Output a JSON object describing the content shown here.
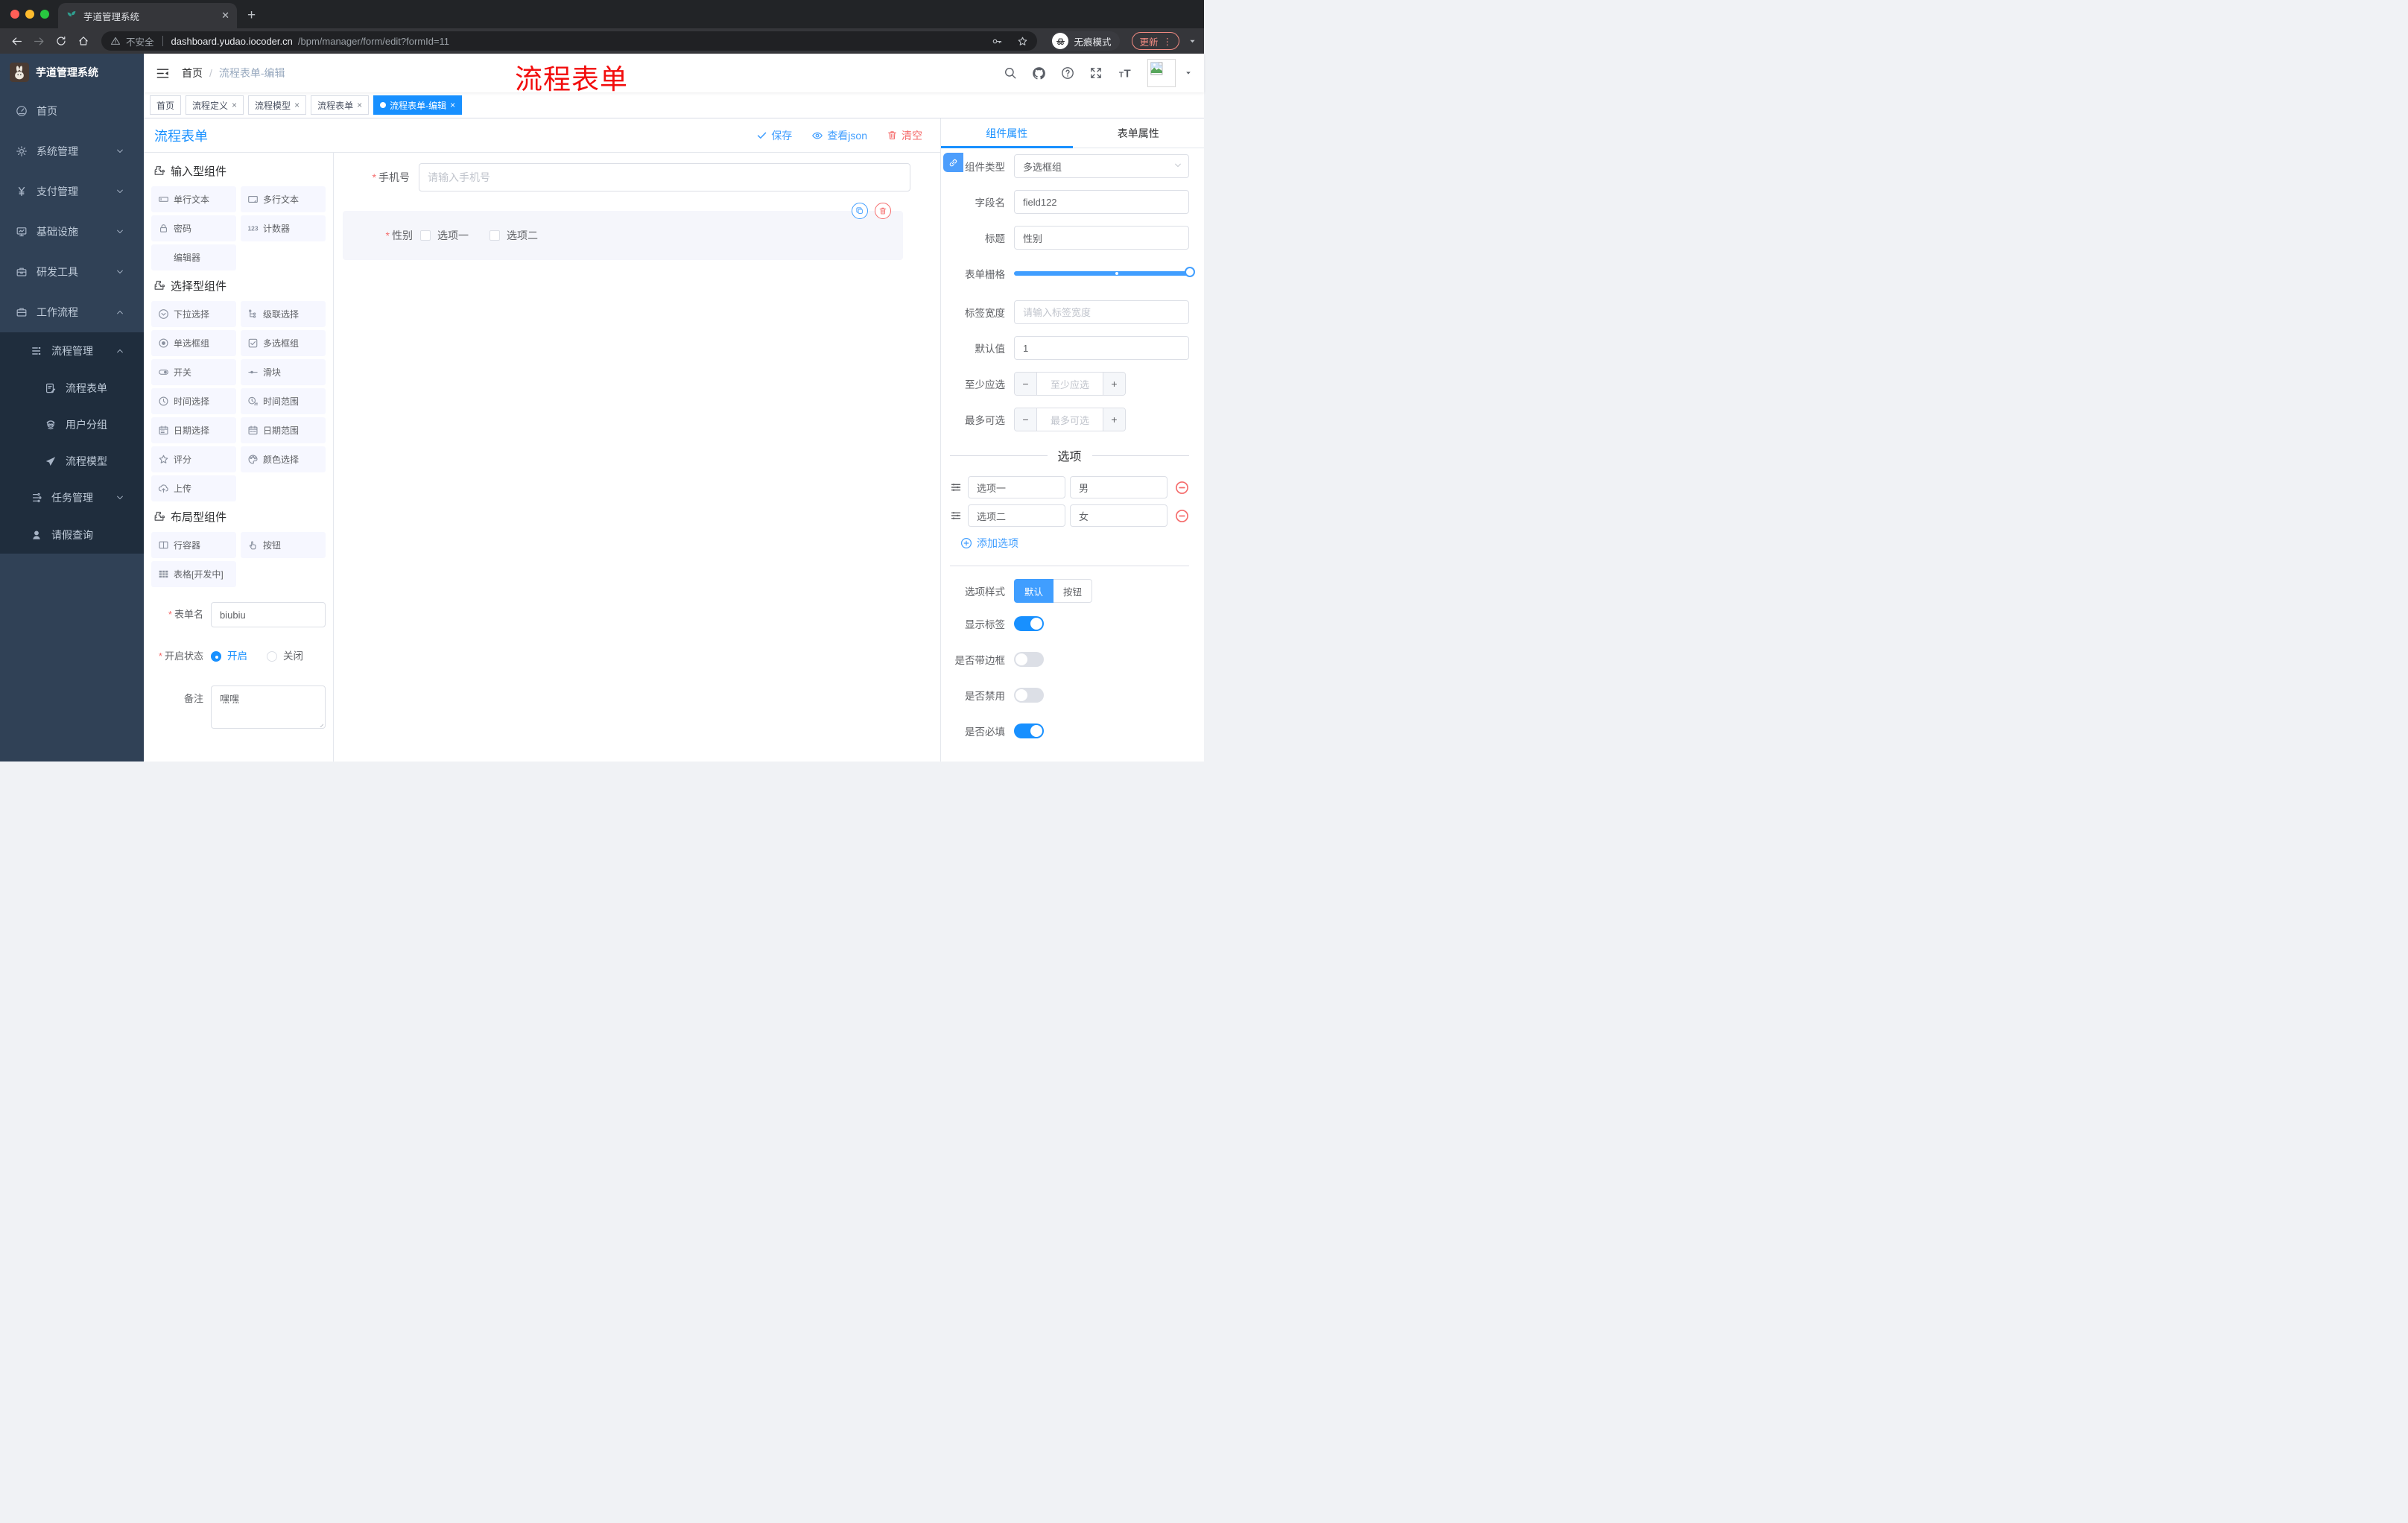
{
  "browser": {
    "tab_title": "芋道管理系统",
    "tab_close": "✕",
    "new_tab": "+",
    "security_label": "不安全",
    "url_host": "dashboard.yudao.iocoder.cn",
    "url_path": "/bpm/manager/form/edit?formId=11",
    "incognito_label": "无痕模式",
    "update_label": "更新",
    "menu_dots": "⋮"
  },
  "sidebar": {
    "logo_title": "芋道管理系统",
    "items": [
      {
        "label": "首页",
        "icon": "dashboard-icon",
        "level": 0,
        "dark": false,
        "chevron": ""
      },
      {
        "label": "系统管理",
        "icon": "gear-icon",
        "level": 0,
        "dark": false,
        "chevron": "down"
      },
      {
        "label": "支付管理",
        "icon": "yen-icon",
        "level": 0,
        "dark": false,
        "chevron": "down"
      },
      {
        "label": "基础设施",
        "icon": "monitor-icon",
        "level": 0,
        "dark": false,
        "chevron": "down"
      },
      {
        "label": "研发工具",
        "icon": "toolbox-icon",
        "level": 0,
        "dark": false,
        "chevron": "down"
      },
      {
        "label": "工作流程",
        "icon": "workflow-icon",
        "level": 0,
        "dark": false,
        "chevron": "up"
      },
      {
        "label": "流程管理",
        "icon": "list-tree-icon",
        "level": 1,
        "dark": true,
        "chevron": "up"
      },
      {
        "label": "流程表单",
        "icon": "doc-edit-icon",
        "level": 2,
        "dark": true,
        "chevron": ""
      },
      {
        "label": "用户分组",
        "icon": "user-group-icon",
        "level": 2,
        "dark": true,
        "chevron": ""
      },
      {
        "label": "流程模型",
        "icon": "paper-plane-icon",
        "level": 2,
        "dark": true,
        "chevron": ""
      },
      {
        "label": "任务管理",
        "icon": "tree-icon",
        "level": 1,
        "dark": true,
        "chevron": "down"
      },
      {
        "label": "请假查询",
        "icon": "user-icon",
        "level": 1,
        "dark": true,
        "chevron": ""
      }
    ]
  },
  "navbar": {
    "breadcrumb": [
      "首页",
      "流程表单-编辑"
    ],
    "breadcrumb_separator": "/",
    "annotation": "流程表单"
  },
  "tags": [
    {
      "label": "首页",
      "closable": false,
      "active": false
    },
    {
      "label": "流程定义",
      "closable": true,
      "active": false
    },
    {
      "label": "流程模型",
      "closable": true,
      "active": false
    },
    {
      "label": "流程表单",
      "closable": true,
      "active": false
    },
    {
      "label": "流程表单-编辑",
      "closable": true,
      "active": true
    }
  ],
  "toolbar": {
    "title": "流程表单",
    "save_label": "保存",
    "view_json_label": "查看json",
    "clear_label": "清空"
  },
  "components_panel": {
    "sections": [
      {
        "title": "输入型组件",
        "items": [
          {
            "label": "单行文本",
            "icon": "input-icon"
          },
          {
            "label": "多行文本",
            "icon": "textarea-icon"
          },
          {
            "label": "密码",
            "icon": "lock-icon"
          },
          {
            "label": "计数器",
            "icon": "counter-icon"
          },
          {
            "label": "编辑器",
            "icon": ""
          }
        ]
      },
      {
        "title": "选择型组件",
        "items": [
          {
            "label": "下拉选择",
            "icon": "select-icon"
          },
          {
            "label": "级联选择",
            "icon": "cascade-icon"
          },
          {
            "label": "单选框组",
            "icon": "radio-icon"
          },
          {
            "label": "多选框组",
            "icon": "checkbox-icon"
          },
          {
            "label": "开关",
            "icon": "switch-icon"
          },
          {
            "label": "滑块",
            "icon": "slider-icon"
          },
          {
            "label": "时间选择",
            "icon": "clock-icon"
          },
          {
            "label": "时间范围",
            "icon": "clock-range-icon"
          },
          {
            "label": "日期选择",
            "icon": "calendar-icon"
          },
          {
            "label": "日期范围",
            "icon": "calendar-range-icon"
          },
          {
            "label": "评分",
            "icon": "star-icon"
          },
          {
            "label": "颜色选择",
            "icon": "palette-icon"
          },
          {
            "label": "上传",
            "icon": "upload-icon"
          }
        ]
      },
      {
        "title": "布局型组件",
        "items": [
          {
            "label": "行容器",
            "icon": "row-container-icon"
          },
          {
            "label": "按钮",
            "icon": "hand-icon"
          },
          {
            "label": "表格[开发中]",
            "icon": "table-icon"
          }
        ]
      }
    ],
    "meta": {
      "form_name_label": "表单名",
      "form_name_value": "biubiu",
      "status_label": "开启状态",
      "status_on": "开启",
      "status_off": "关闭",
      "status_selected": "开启",
      "remark_label": "备注",
      "remark_value": "嘿嘿"
    }
  },
  "canvas": {
    "phone": {
      "label": "手机号",
      "placeholder": "请输入手机号",
      "required": true
    },
    "gender": {
      "label": "性别",
      "required": true,
      "options": [
        "选项一",
        "选项二"
      ],
      "checked": []
    }
  },
  "props": {
    "tabs": [
      "组件属性",
      "表单属性"
    ],
    "active_tab": "组件属性",
    "component_type_label": "组件类型",
    "component_type_value": "多选框组",
    "field_name_label": "字段名",
    "field_name_value": "field122",
    "title_label": "标题",
    "title_value": "性别",
    "grid_label": "表单栅格",
    "label_width_label": "标签宽度",
    "label_width_placeholder": "请输入标签宽度",
    "default_label": "默认值",
    "default_value": "1",
    "min_label": "至少应选",
    "min_placeholder": "至少应选",
    "max_label": "最多可选",
    "max_placeholder": "最多可选",
    "minus_sign": "−",
    "plus_sign": "+",
    "options_divider": "选项",
    "options": [
      {
        "label": "选项一",
        "value": "男"
      },
      {
        "label": "选项二",
        "value": "女"
      }
    ],
    "add_option_label": "添加选项",
    "style_label": "选项样式",
    "style_options": [
      "默认",
      "按钮"
    ],
    "style_active": "默认",
    "switches": [
      {
        "label": "显示标签",
        "on": true
      },
      {
        "label": "是否带边框",
        "on": false
      },
      {
        "label": "是否禁用",
        "on": false
      },
      {
        "label": "是否必填",
        "on": true
      }
    ]
  },
  "colors": {
    "accent_blue": "#1890ff",
    "element_blue": "#409eff",
    "danger_red": "#f56c6c",
    "sidebar_bg": "#304156",
    "submenu_bg": "#1f2d3d"
  }
}
